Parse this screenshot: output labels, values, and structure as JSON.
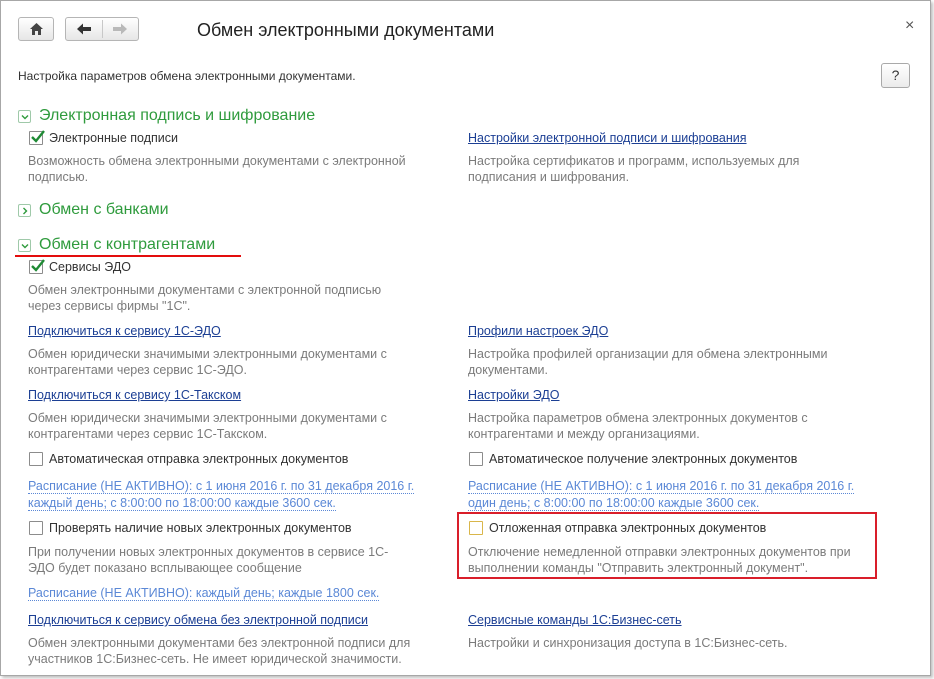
{
  "window": {
    "title": "Обмен электронными документами",
    "close_label": "×",
    "intro": "Настройка параметров обмена электронными документами.",
    "help_label": "?"
  },
  "toolbar": {
    "home_icon": "home-icon",
    "back_icon": "arrow-left-icon",
    "forward_icon": "arrow-right-icon"
  },
  "colors": {
    "section_title": "#2f9b3d",
    "link": "#1c3f94",
    "schedule_link": "#5b88d6",
    "description": "#7b7b7b",
    "highlight": "#d91e2a"
  },
  "sections": {
    "signature": {
      "title": "Электронная подпись и шифрование",
      "expanded": true,
      "checkbox_label": "Электронные подписи",
      "checkbox_checked": true,
      "checkbox_desc": "Возможность обмена электронными документами с электронной подписью.",
      "link": "Настройки электронной подписи и шифрования",
      "link_desc": "Настройка сертификатов и программ, используемых для подписания и шифрования."
    },
    "banks": {
      "title": "Обмен с банками",
      "expanded": false
    },
    "counterparties": {
      "title": "Обмен с контрагентами",
      "expanded": true,
      "edo_label": "Сервисы ЭДО",
      "edo_checked": true,
      "edo_desc": "Обмен электронными документами с электронной подписью через сервисы фирмы \"1С\".",
      "connect_1c_edo": "Подключиться к сервису 1С-ЭДО",
      "connect_1c_edo_desc": "Обмен юридически значимыми электронными документами с контрагентами через сервис 1С-ЭДО.",
      "profiles": "Профили настроек ЭДО",
      "profiles_desc": "Настройка профилей организации для обмена электронными документами.",
      "connect_taxcom": "Подключиться к сервису 1С-Такском",
      "connect_taxcom_desc": "Обмен юридически значимыми электронными документами с контрагентами через сервис 1С-Такском.",
      "edo_settings": "Настройки ЭДО",
      "edo_settings_desc": "Настройка параметров обмена электронных документов с контрагентами и между организациями.",
      "auto_send_label": "Автоматическая отправка электронных документов",
      "auto_send_checked": false,
      "auto_send_schedule": "Расписание (НЕ АКТИВНО): с 1 июня 2016 г. по 31 декабря 2016 г. каждый  день; с 8:00:00 по 18:00:00 каждые 3600 сек.",
      "auto_receive_label": "Автоматическое получение электронных документов",
      "auto_receive_checked": false,
      "auto_receive_schedule": "Расписание (НЕ АКТИВНО): с 1 июня 2016 г. по 31 декабря 2016 г. один день; с 8:00:00 по 18:00:00 каждые 3600 сек.",
      "check_new_label": "Проверять наличие новых электронных документов",
      "check_new_checked": false,
      "check_new_desc": "При получении новых электронных документов в сервисе 1С-ЭДО будет показано всплывающее сообщение",
      "check_new_schedule": "Расписание (НЕ АКТИВНО): каждый  день; каждые 1800 сек.",
      "deferred_label": "Отложенная отправка электронных документов",
      "deferred_checked": false,
      "deferred_desc": "Отключение немедленной отправки электронных документов при выполнении команды \"Отправить электронный документ\".",
      "connect_no_sign": "Подключиться к сервису обмена без электронной подписи",
      "connect_no_sign_desc": "Обмен электронными документами без электронной подписи для участников 1С:Бизнес-сеть. Не имеет юридической значимости.",
      "service_cmds": "Сервисные команды 1С:Бизнес-сеть",
      "service_cmds_desc": "Настройки и синхронизация доступа в 1С:Бизнес-сеть."
    }
  }
}
